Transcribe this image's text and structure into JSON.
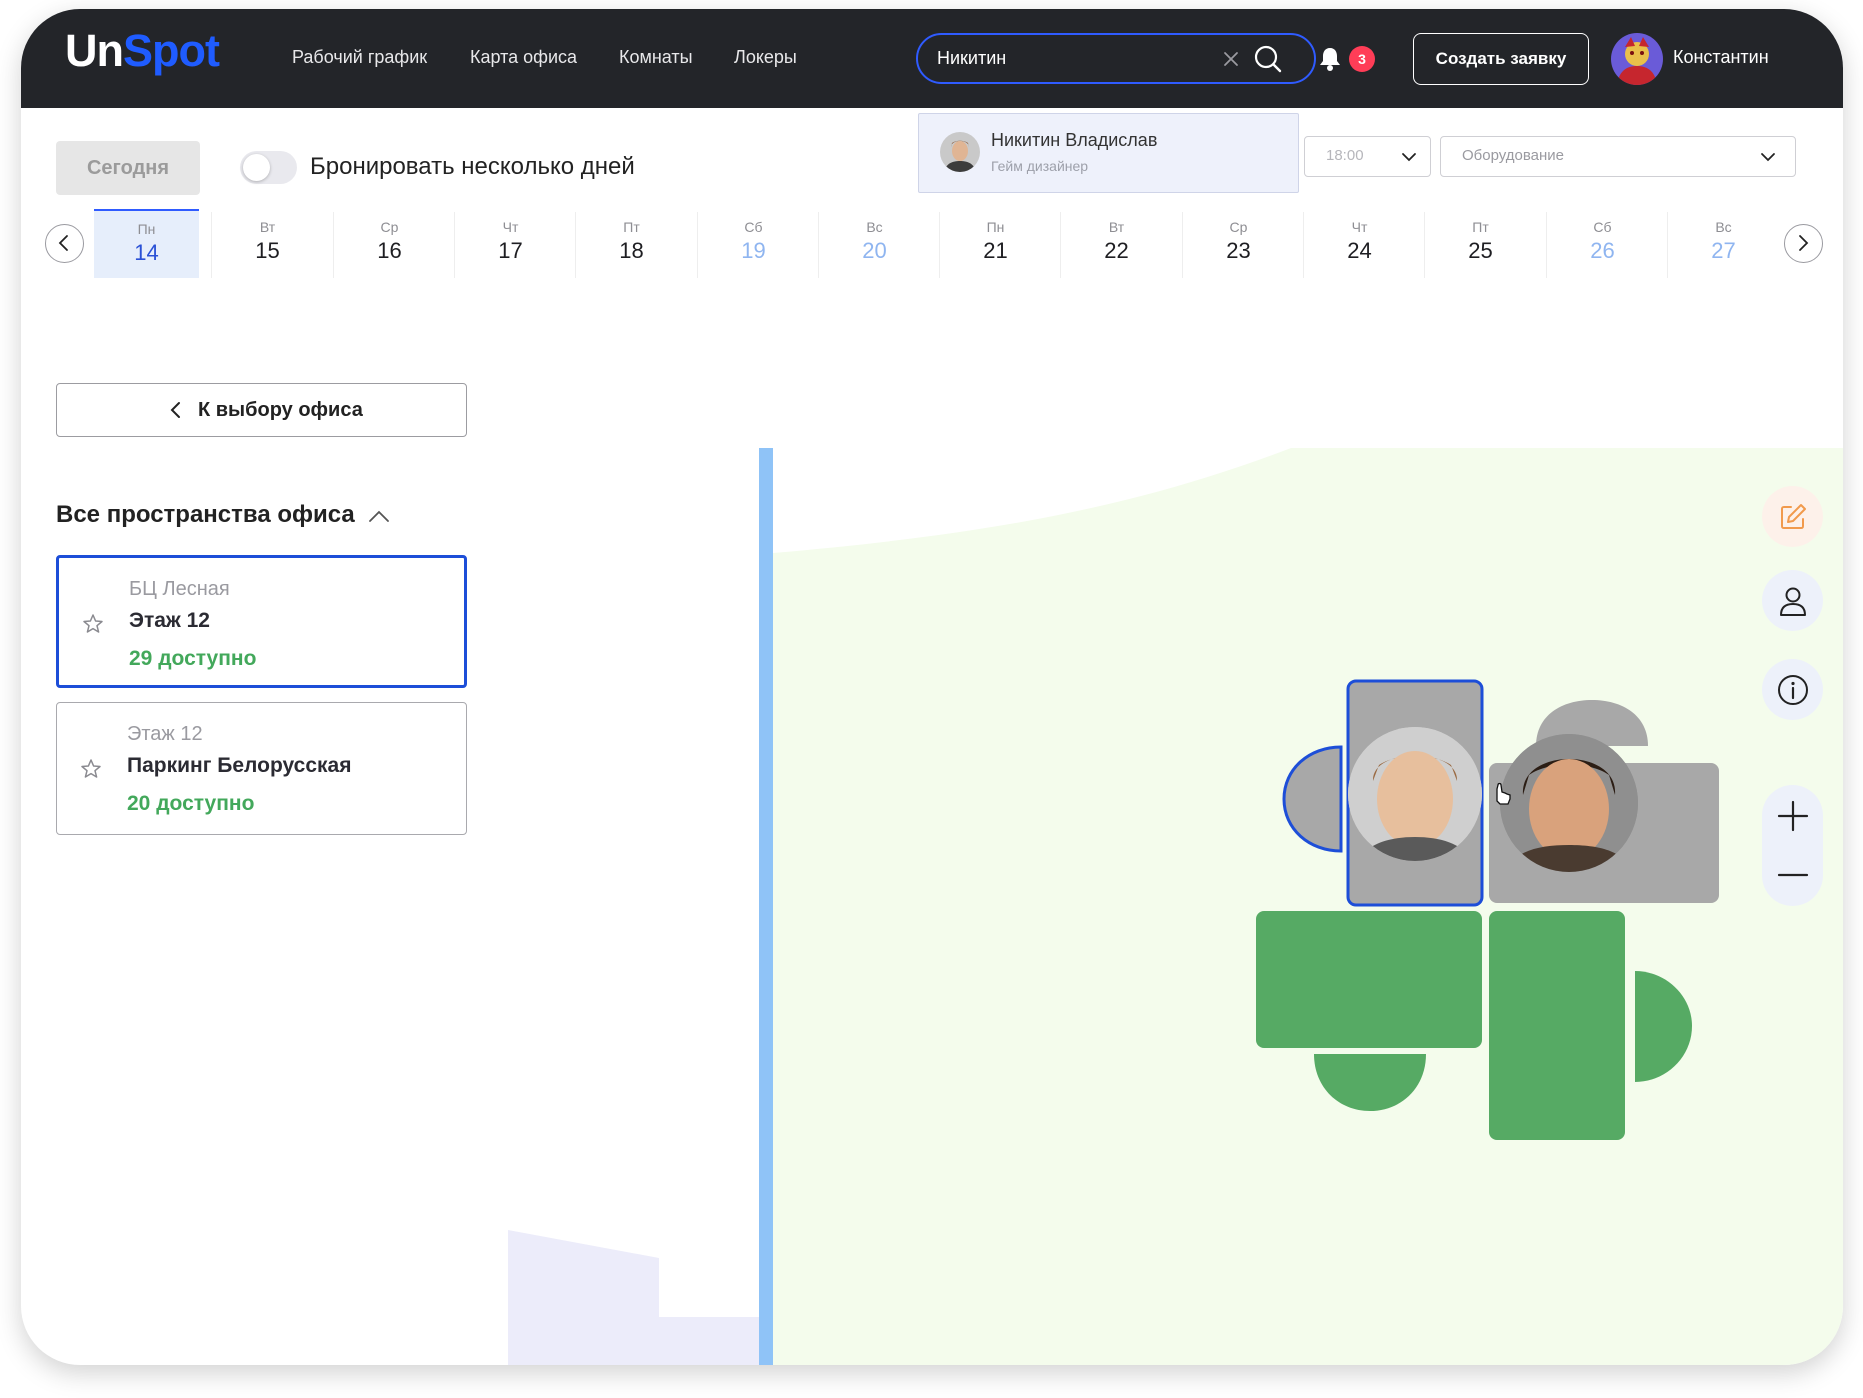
{
  "header": {
    "logo_part1": "Un",
    "logo_part2": "Spot",
    "nav": [
      "Рабочий график",
      "Карта офиса",
      "Комнаты",
      "Локеры"
    ],
    "search": {
      "value": "Никитин"
    },
    "notifications_count": "3",
    "create_button": "Создать заявку",
    "user_name": "Константин"
  },
  "search_results": [
    {
      "name": "Никитин Владислав",
      "role": "Гейм дизайнер"
    }
  ],
  "toolbar": {
    "today_button": "Сегодня",
    "multi_day_label": "Бронировать несколько дней",
    "multi_day_enabled": false,
    "time_value": "18:00",
    "equipment_placeholder": "Оборудование"
  },
  "dates": [
    {
      "dow": "Пн",
      "num": "14",
      "selected": true,
      "weekend": false
    },
    {
      "dow": "Вт",
      "num": "15",
      "selected": false,
      "weekend": false
    },
    {
      "dow": "Ср",
      "num": "16",
      "selected": false,
      "weekend": false
    },
    {
      "dow": "Чт",
      "num": "17",
      "selected": false,
      "weekend": false
    },
    {
      "dow": "Пт",
      "num": "18",
      "selected": false,
      "weekend": false
    },
    {
      "dow": "Сб",
      "num": "19",
      "selected": false,
      "weekend": true
    },
    {
      "dow": "Вс",
      "num": "20",
      "selected": false,
      "weekend": true
    },
    {
      "dow": "Пн",
      "num": "21",
      "selected": false,
      "weekend": false
    },
    {
      "dow": "Вт",
      "num": "22",
      "selected": false,
      "weekend": false
    },
    {
      "dow": "Ср",
      "num": "23",
      "selected": false,
      "weekend": false
    },
    {
      "dow": "Чт",
      "num": "24",
      "selected": false,
      "weekend": false
    },
    {
      "dow": "Пт",
      "num": "25",
      "selected": false,
      "weekend": false
    },
    {
      "dow": "Сб",
      "num": "26",
      "selected": false,
      "weekend": true
    },
    {
      "dow": "Вс",
      "num": "27",
      "selected": false,
      "weekend": true
    }
  ],
  "sidebar": {
    "back_button": "К выбору офиса",
    "section_title": "Все пространства офиса",
    "spaces": [
      {
        "subtitle": "БЦ Лесная",
        "name": "Этаж 12",
        "available": "29 доступно",
        "selected": true
      },
      {
        "subtitle": "Этаж 12",
        "name": "Паркинг Белорусская",
        "available": "20 доступно",
        "selected": false
      }
    ]
  },
  "map": {
    "tools": [
      "edit-icon",
      "person-icon",
      "info-icon",
      "zoom-in-icon",
      "zoom-out-icon"
    ],
    "colors": {
      "free": "#56aa64",
      "busy": "#a8a8a8",
      "floor": "#f4fcec",
      "wall": "#8fc3f7",
      "highlight": "#1d4ed8"
    }
  }
}
